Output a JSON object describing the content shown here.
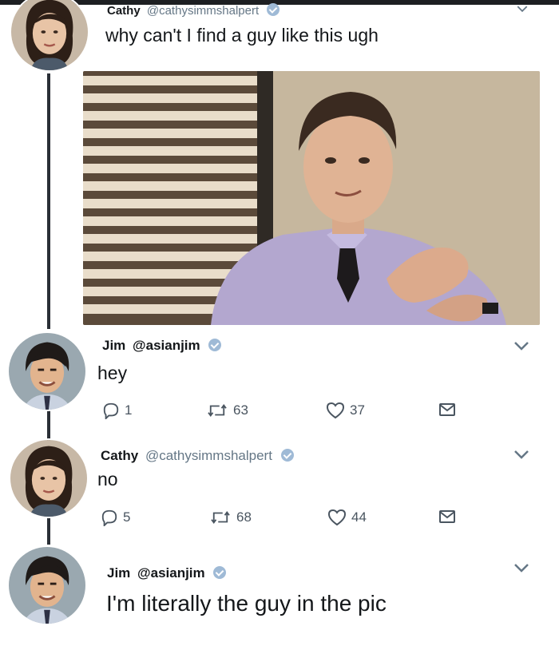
{
  "thread": [
    {
      "author": {
        "name": "Cathy",
        "handle": "@cathysimmshalpert",
        "verified": true
      },
      "text": "why can't I find a guy like this ugh",
      "has_media": true
    },
    {
      "author": {
        "name": "Jim",
        "handle": "@asianjim",
        "verified": true
      },
      "text": "hey",
      "stats": {
        "replies": "1",
        "retweets": "63",
        "likes": "37"
      }
    },
    {
      "author": {
        "name": "Cathy",
        "handle": "@cathysimmshalpert",
        "verified": true
      },
      "text": "no",
      "stats": {
        "replies": "5",
        "retweets": "68",
        "likes": "44"
      }
    },
    {
      "author": {
        "name": "Jim",
        "handle": "@asianjim",
        "verified": true
      },
      "text": "I'm literally the guy in the pic"
    }
  ],
  "colors": {
    "text": "#14171a",
    "muted": "#657786",
    "verified": "#9fbad6",
    "thread_line": "#2a2f36"
  },
  "icons": [
    "reply-icon",
    "retweet-icon",
    "like-icon",
    "dm-icon",
    "chevron-down-icon",
    "verified-icon"
  ]
}
